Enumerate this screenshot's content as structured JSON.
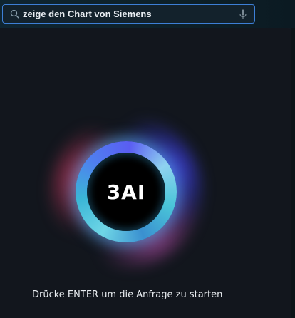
{
  "search": {
    "value": "zeige den Chart von Siemens",
    "placeholder": ""
  },
  "icons": {
    "search": "search-icon",
    "mic": "microphone-icon"
  },
  "orb": {
    "logo": "3AI"
  },
  "hint": "Drücke ENTER um die Anfrage zu starten",
  "colors": {
    "accent": "#3d7fd6",
    "background": "#12161d",
    "orb_cyan": "#4ac5d8",
    "orb_blue": "#5a5df2",
    "orb_pink": "#ec406a"
  }
}
